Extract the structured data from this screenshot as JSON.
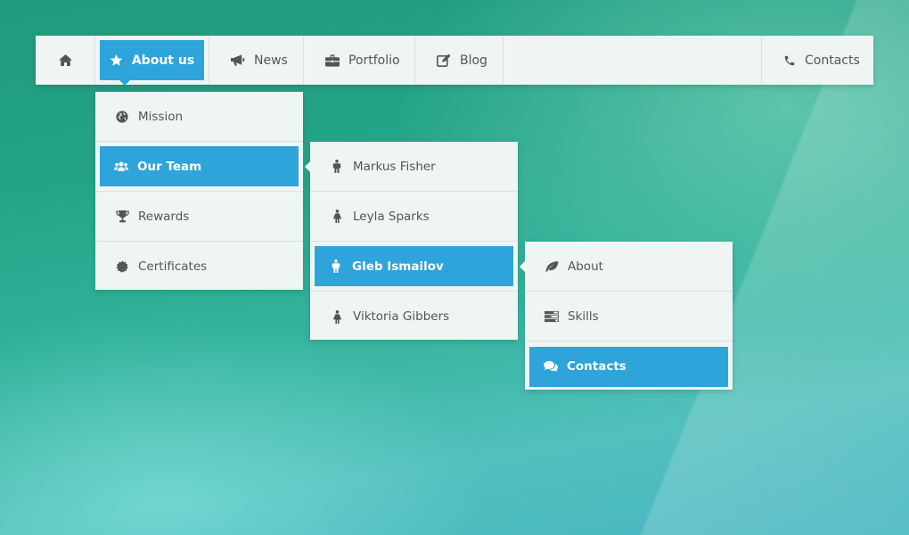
{
  "nav": {
    "home_icon": "home-icon",
    "about": "About us",
    "news": "News",
    "portfolio": "Portfolio",
    "blog": "Blog",
    "contacts": "Contacts"
  },
  "submenu_about": {
    "items": [
      "Mission",
      "Our Team",
      "Rewards",
      "Certificates"
    ],
    "active": "Our Team"
  },
  "submenu_team": {
    "items": [
      "Markus Fisher",
      "Leyla Sparks",
      "Gleb Ismailov",
      "Viktoria Gibbers"
    ],
    "active": "Gleb Ismailov"
  },
  "submenu_person": {
    "items": [
      "About",
      "Skills",
      "Contacts"
    ],
    "active": "Contacts"
  },
  "colors": {
    "accent": "#2ea4db",
    "panel": "#eef5f3",
    "text": "#555555"
  }
}
